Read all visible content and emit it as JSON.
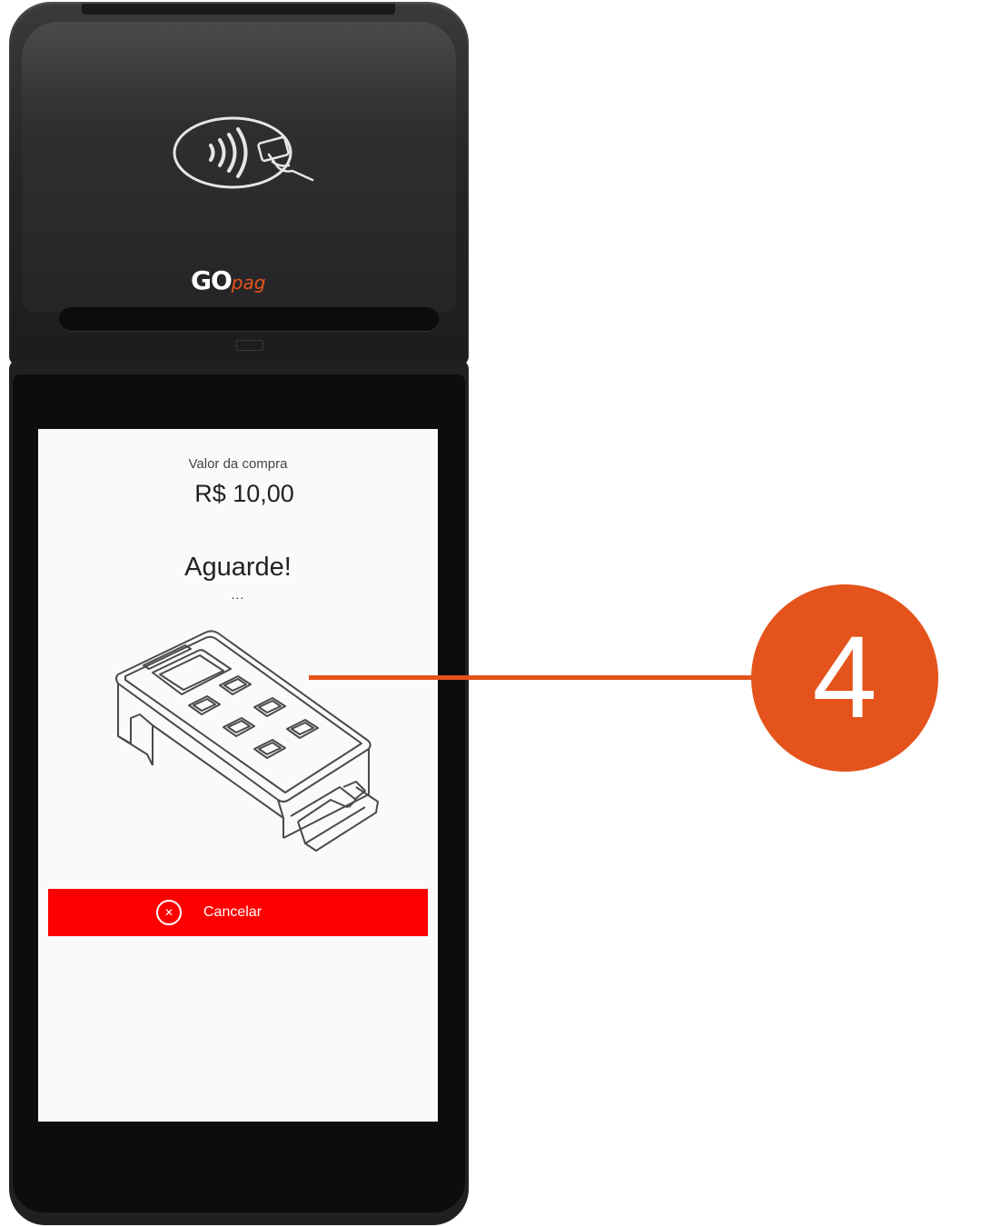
{
  "device": {
    "brand_go": "GO",
    "brand_pag": "pag",
    "nfc_icon": "contactless-payment-icon"
  },
  "screen": {
    "amount_label": "Valor da compra",
    "amount_value": "R$ 10,00",
    "status_title": "Aguarde!",
    "status_dots": "...",
    "illustration": "card-terminal-icon",
    "cancel_button": {
      "label": "Cancelar",
      "icon": "close-circle-icon",
      "color": "#ff0000"
    }
  },
  "callout": {
    "number": "4",
    "color": "#e4531b"
  }
}
